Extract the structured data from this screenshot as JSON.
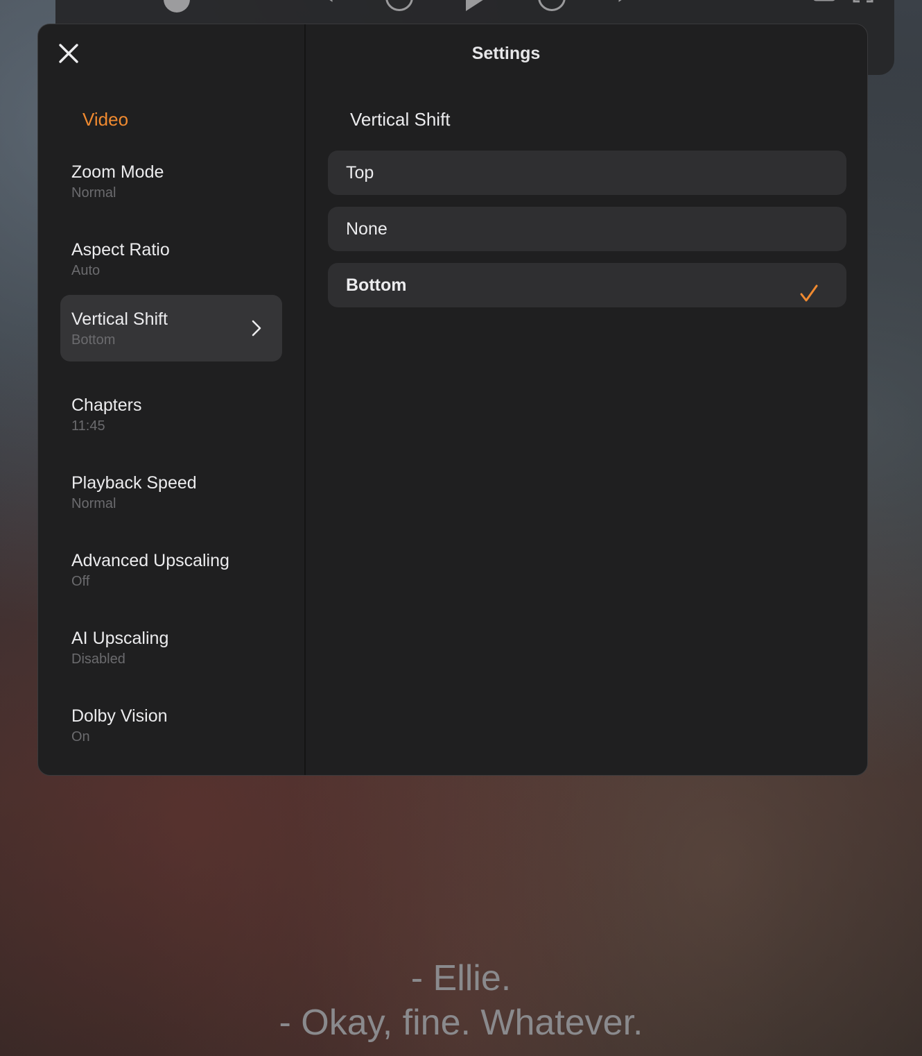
{
  "panel": {
    "title": "Settings",
    "section_title": "Video"
  },
  "menu": {
    "items": [
      {
        "label": "Zoom Mode",
        "value": "Normal"
      },
      {
        "label": "Aspect Ratio",
        "value": "Auto"
      },
      {
        "label": "Vertical Shift",
        "value": "Bottom"
      },
      {
        "label": "Chapters",
        "value": "11:45"
      },
      {
        "label": "Playback Speed",
        "value": "Normal"
      },
      {
        "label": "Advanced Upscaling",
        "value": "Off"
      },
      {
        "label": "AI Upscaling",
        "value": "Disabled"
      },
      {
        "label": "Dolby Vision",
        "value": "On"
      }
    ]
  },
  "detail": {
    "title": "Vertical Shift",
    "options": [
      {
        "label": "Top"
      },
      {
        "label": "None"
      },
      {
        "label": "Bottom"
      }
    ],
    "selected_label": "Bottom"
  },
  "subtitles": {
    "line1": "- Ellie.",
    "line2": "- Okay, fine. Whatever."
  },
  "colors": {
    "accent": "#f08a30",
    "panel_bg": "#1f1f20",
    "row_bg": "#2f2f31"
  },
  "icons": {
    "close": "close-icon",
    "chevron": "chevron-right-icon",
    "check": "checkmark-icon"
  }
}
